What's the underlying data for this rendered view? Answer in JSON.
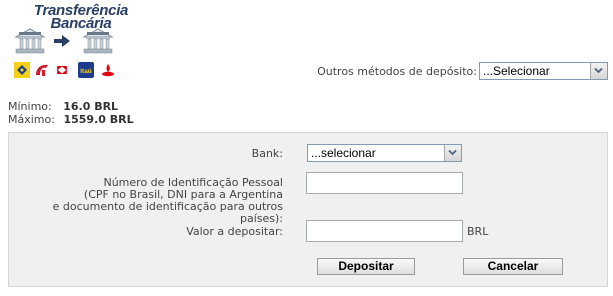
{
  "header": {
    "title_line1": "Transferência",
    "title_line2": "Bancária"
  },
  "icons": {
    "bank": "bank-building-icon",
    "arrow": "arrow-right-icon",
    "brands": [
      "banco-do-brasil-icon",
      "bradesco-icon",
      "hsbc-icon",
      "itau-icon",
      "santander-icon"
    ],
    "itau_text": "Itaú"
  },
  "other_methods": {
    "label": "Outros métodos de depósito:",
    "selected": "...Selecionar"
  },
  "limits": {
    "min_label": "Mínimo:",
    "min_value": "16.0 BRL",
    "max_label": "Máximo:",
    "max_value": "1559.0 BRL"
  },
  "form": {
    "bank_label": "Bank:",
    "bank_selected": "...selecionar",
    "id_label_line1": "Número de Identificação Pessoal",
    "id_label_line2": "(CPF no Brasil, DNI para a Argentina",
    "id_label_line3": "e documento de identificação para outros países):",
    "id_value": "",
    "amount_label": "Valor a depositar:",
    "amount_value": "",
    "currency": "BRL",
    "submit_label": "Depositar",
    "cancel_label": "Cancelar"
  },
  "colors": {
    "title": "#2a3f66",
    "panel_bg": "#f0f0f0",
    "select_border": "#7f9db9"
  }
}
